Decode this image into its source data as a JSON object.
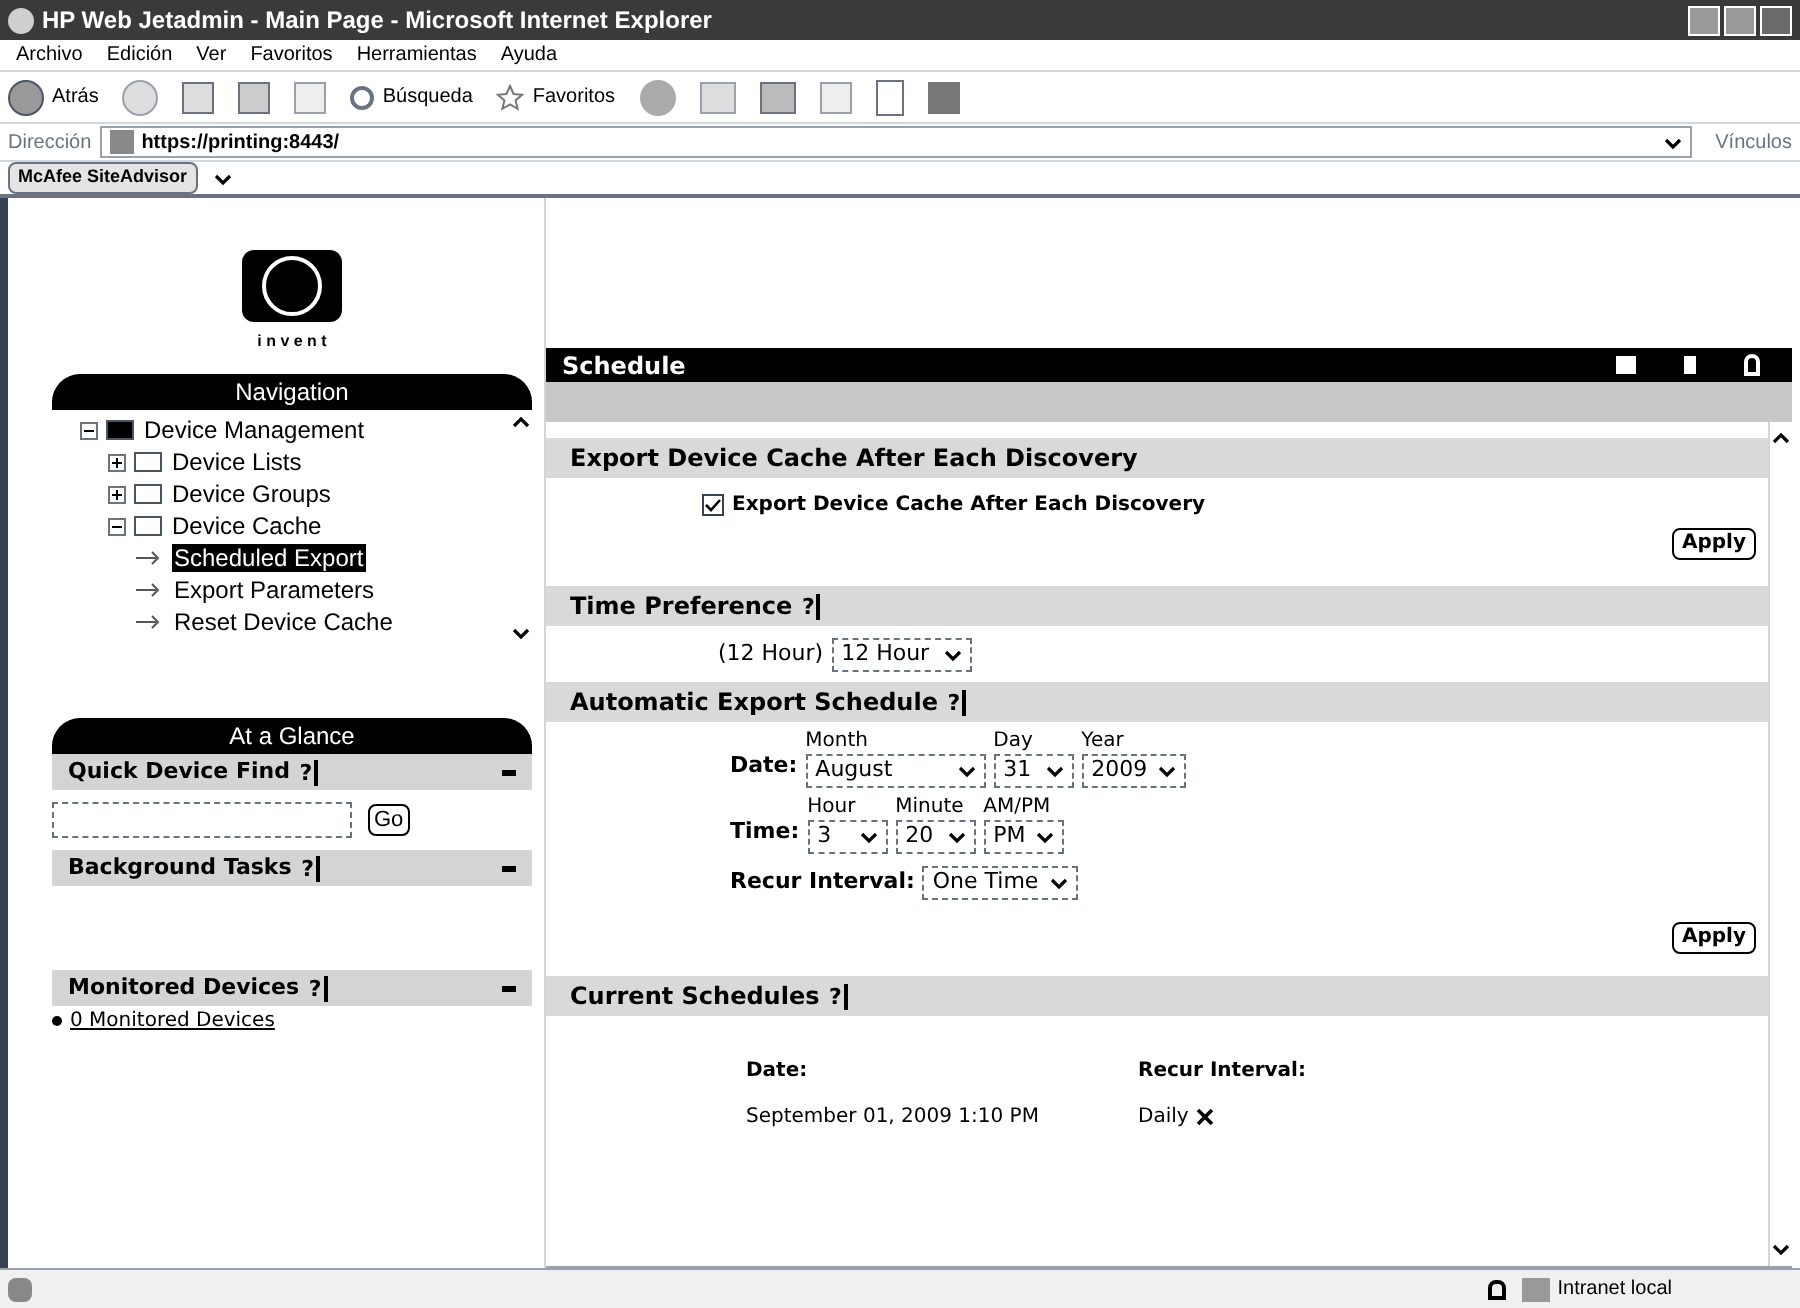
{
  "window": {
    "title": "HP Web Jetadmin - Main Page - Microsoft Internet Explorer"
  },
  "menu": [
    "Archivo",
    "Edición",
    "Ver",
    "Favoritos",
    "Herramientas",
    "Ayuda"
  ],
  "toolbar": {
    "back": "Atrás",
    "search": "Búsqueda",
    "favorites": "Favoritos"
  },
  "address": {
    "label": "Dirección",
    "value": "https://printing:8443/",
    "links": "Vínculos"
  },
  "addon": {
    "label": "McAfee SiteAdvisor"
  },
  "logo": {
    "tagline": "i n v e n t"
  },
  "navigation": {
    "title": "Navigation",
    "tree": [
      {
        "label": "Device Management",
        "expanded": true,
        "selected": false,
        "children": [
          {
            "label": "Device Lists",
            "expanded": false,
            "selected": false
          },
          {
            "label": "Device Groups",
            "expanded": false,
            "selected": false
          },
          {
            "label": "Device Cache",
            "expanded": true,
            "selected": false,
            "children": [
              {
                "label": "Scheduled Export",
                "selected": true
              },
              {
                "label": "Export Parameters",
                "selected": false
              },
              {
                "label": "Reset Device Cache",
                "selected": false
              }
            ]
          }
        ]
      }
    ]
  },
  "glance": {
    "title": "At a Glance",
    "sections": [
      {
        "kind": "search",
        "title": "Quick Device Find",
        "help": "?",
        "button": "Go"
      },
      {
        "kind": "empty",
        "title": "Background Tasks",
        "help": "?"
      },
      {
        "kind": "links",
        "title": "Monitored Devices",
        "help": "?",
        "links": [
          "0 Monitored Devices"
        ]
      }
    ]
  },
  "page": {
    "title": "Schedule",
    "export_section": {
      "title": "Export Device Cache After Each Discovery",
      "checkbox": {
        "label": "Export Device Cache After Each Discovery",
        "checked": true
      },
      "button": "Apply"
    },
    "time_section": {
      "title": "Time Preference",
      "help": "?",
      "prefix": "(12 Hour)",
      "value": "12 Hour"
    },
    "auto_section": {
      "title": "Automatic Export Schedule",
      "help": "?",
      "date": {
        "label": "Date:",
        "fields": [
          {
            "label": "Month",
            "value": "August"
          },
          {
            "label": "Day",
            "value": "31"
          },
          {
            "label": "Year",
            "value": "2009"
          }
        ]
      },
      "time": {
        "label": "Time:",
        "fields": [
          {
            "label": "Hour",
            "value": "3"
          },
          {
            "label": "Minute",
            "value": "20"
          },
          {
            "label": "AM/PM",
            "value": "PM"
          }
        ]
      },
      "recur": {
        "label": "Recur Interval:",
        "value": "One Time"
      },
      "button": "Apply"
    },
    "current_section": {
      "title": "Current Schedules",
      "help": "?",
      "columns": [
        "Date:",
        "Recur Interval:"
      ],
      "rows": [
        [
          "September 01, 2009 1:10 PM",
          "Daily"
        ]
      ]
    }
  },
  "status_bar": {
    "zone": "Intranet local"
  }
}
